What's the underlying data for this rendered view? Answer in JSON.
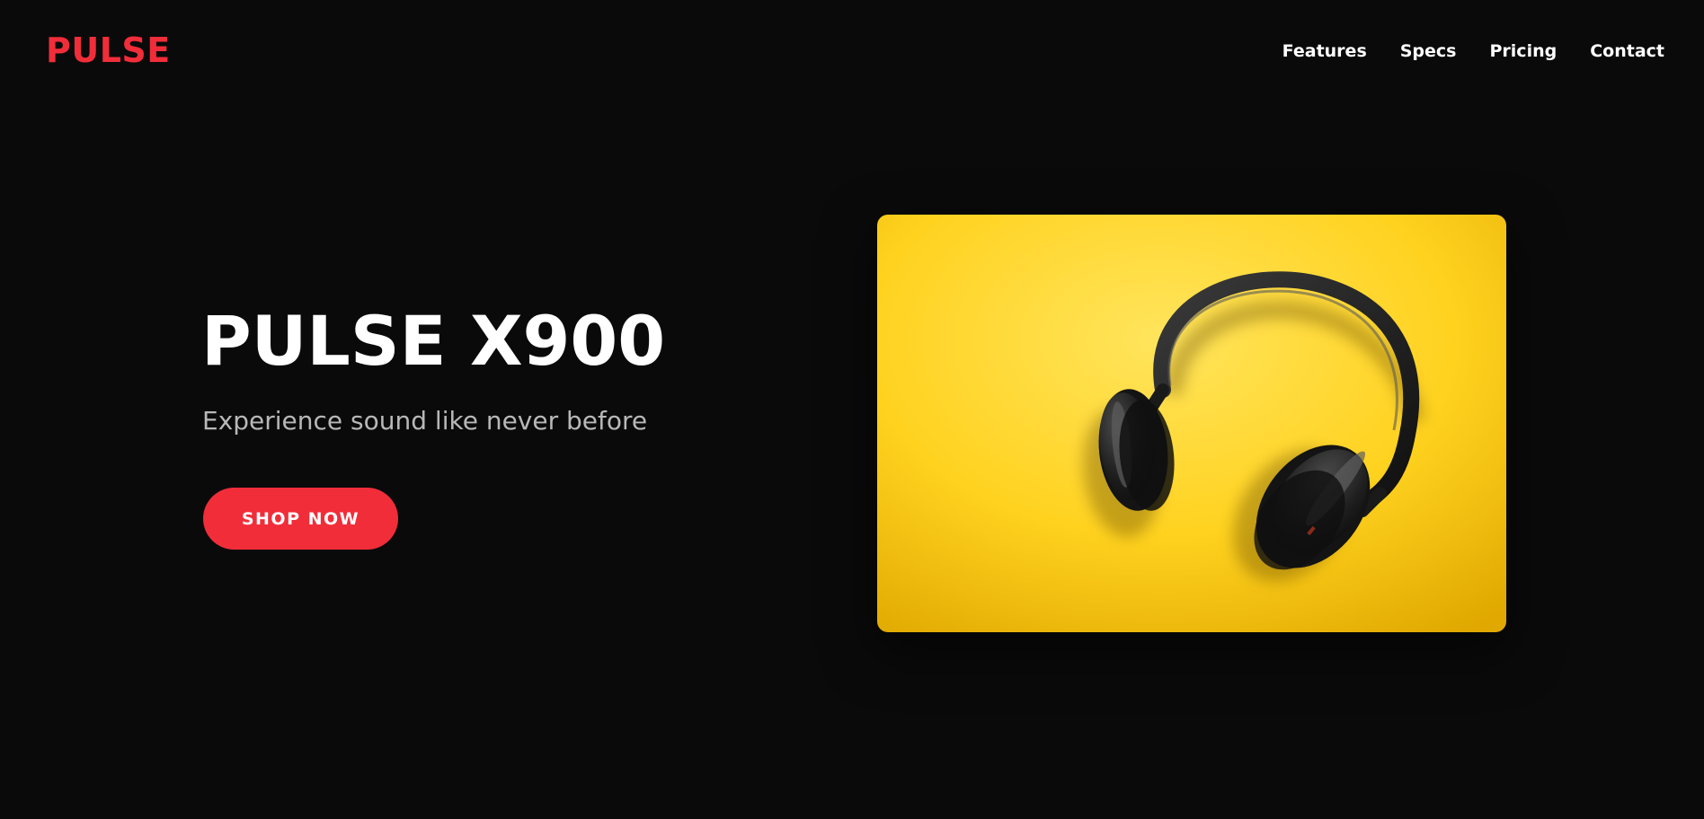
{
  "brand": {
    "logo_text": "PULSE",
    "accent_color": "#f12d3a"
  },
  "nav": {
    "items": [
      {
        "label": "Features"
      },
      {
        "label": "Specs"
      },
      {
        "label": "Pricing"
      },
      {
        "label": "Contact"
      }
    ]
  },
  "hero": {
    "title": "PULSE X900",
    "subtitle": "Experience sound like never before",
    "cta_label": "SHOP NOW",
    "image_subject": "black over-ear headphones on yellow background",
    "image_background_color": "#ffd21f"
  }
}
